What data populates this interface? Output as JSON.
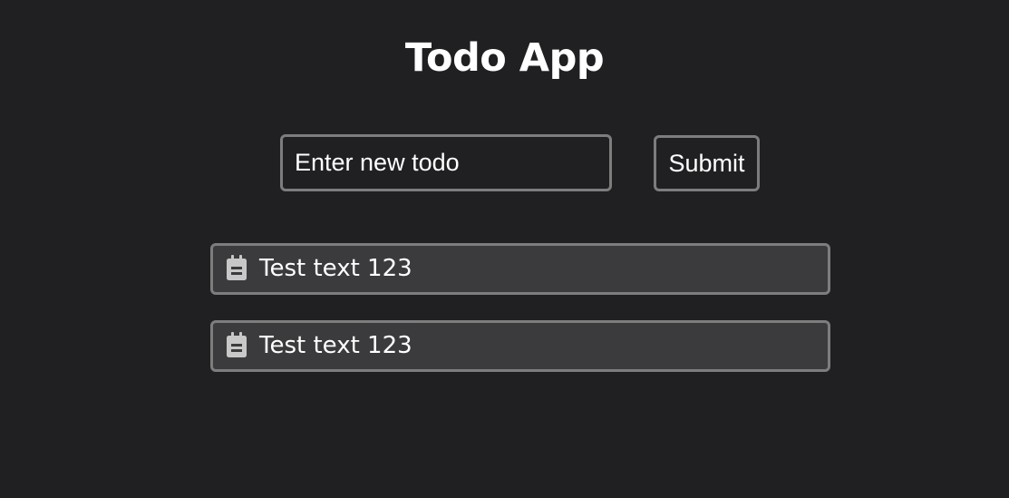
{
  "app": {
    "title": "Todo App"
  },
  "form": {
    "input_placeholder": "Enter new todo",
    "input_value": "",
    "submit_label": "Submit"
  },
  "todos": [
    {
      "text": "Test text 123",
      "icon": "clipboard-icon"
    },
    {
      "text": "Test text 123",
      "icon": "clipboard-icon"
    }
  ],
  "colors": {
    "background": "#202022",
    "item_background": "#3b3b3d",
    "border": "#7d7d7e",
    "text": "#ffffff",
    "icon": "#c8c8c8"
  }
}
